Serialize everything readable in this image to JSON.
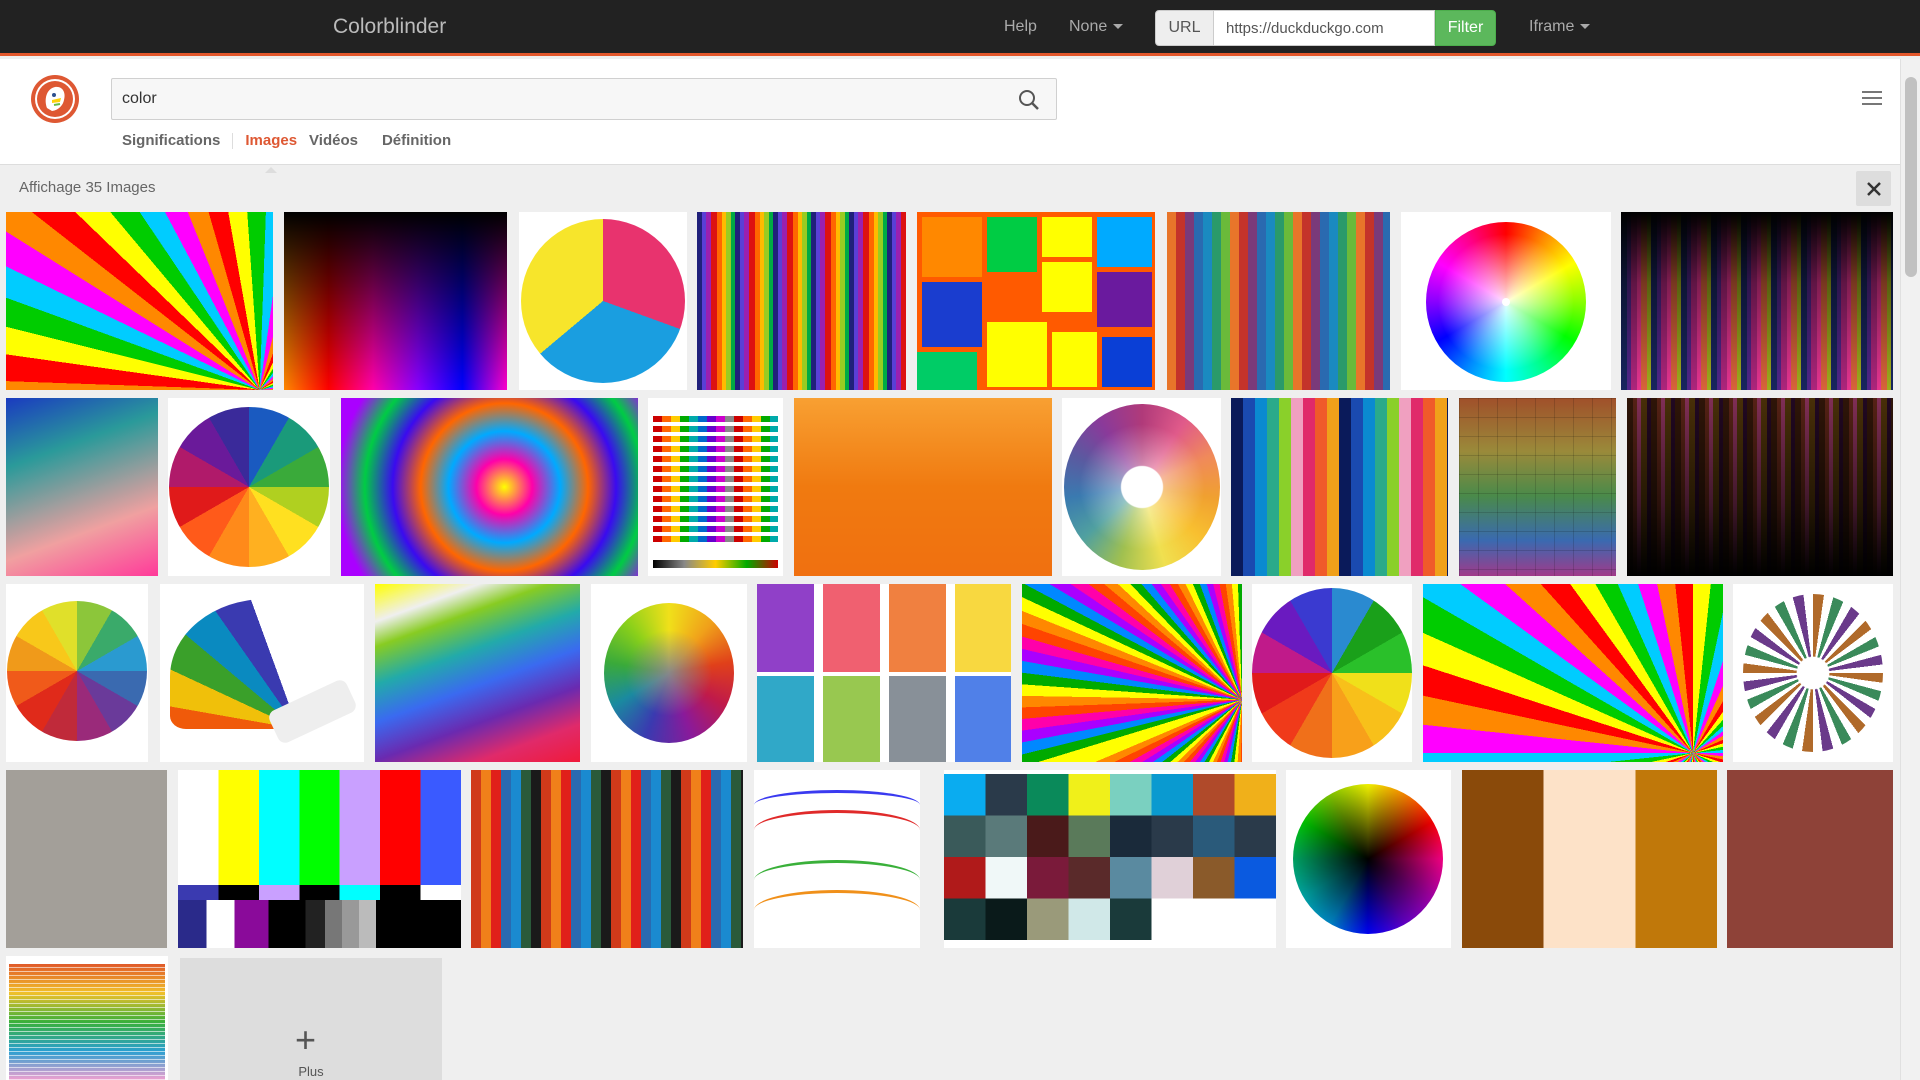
{
  "topbar": {
    "brand": "Colorblinder",
    "help": "Help",
    "mode_select": "None",
    "url_addon": "URL",
    "url_value": "https://duckduckgo.com",
    "filter_label": "Filter",
    "frame_select": "Iframe"
  },
  "search": {
    "query": "color"
  },
  "tabs": [
    "Significations",
    "Images",
    "Vidéos",
    "Définition"
  ],
  "results": {
    "count_text": "Affichage 35 Images",
    "more_label": "Plus",
    "more_symbol": "+"
  },
  "colors": {
    "accent": "#de5833",
    "topbar_bg": "#222222",
    "filter_green": "#5cb85c"
  }
}
